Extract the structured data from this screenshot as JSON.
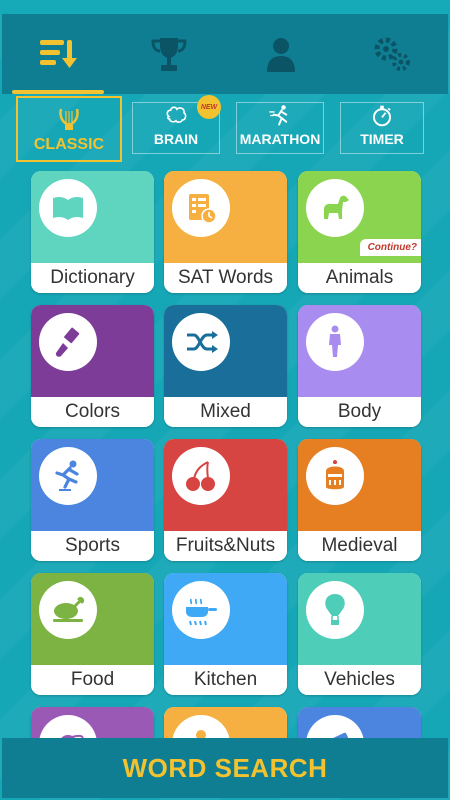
{
  "top_nav": {
    "items": [
      {
        "name": "list-sort-icon",
        "active": true
      },
      {
        "name": "trophy-icon",
        "active": false
      },
      {
        "name": "profile-icon",
        "active": false
      },
      {
        "name": "settings-gears-icon",
        "active": false
      }
    ],
    "accent": "#f2c230"
  },
  "modes": [
    {
      "label": "CLASSIC",
      "icon": "lyre-icon",
      "active": true
    },
    {
      "label": "BRAIN",
      "icon": "brain-icon",
      "badge": "NEW"
    },
    {
      "label": "MARATHON",
      "icon": "runner-icon"
    },
    {
      "label": "TIMER",
      "icon": "stopwatch-icon"
    }
  ],
  "categories": [
    {
      "label": "Dictionary",
      "color": "#5fd4bf",
      "icon": "book-icon"
    },
    {
      "label": "SAT Words",
      "color": "#f5b041",
      "icon": "worksheet-icon"
    },
    {
      "label": "Animals",
      "color": "#8bd450",
      "icon": "dog-icon",
      "note": "Continue?"
    },
    {
      "label": "Colors",
      "color": "#7d3c98",
      "icon": "paintbrush-icon"
    },
    {
      "label": "Mixed",
      "color": "#1a6f9a",
      "icon": "shuffle-icon"
    },
    {
      "label": "Body",
      "color": "#a98cf0",
      "icon": "human-body-icon"
    },
    {
      "label": "Sports",
      "color": "#4b85e0",
      "icon": "skater-icon"
    },
    {
      "label": "Fruits&Nuts",
      "color": "#d64541",
      "icon": "cherries-icon"
    },
    {
      "label": "Medieval",
      "color": "#e67e22",
      "icon": "knight-helmet-icon"
    },
    {
      "label": "Food",
      "color": "#7cb342",
      "icon": "roast-chicken-icon"
    },
    {
      "label": "Kitchen",
      "color": "#3fa9f5",
      "icon": "frying-pan-icon"
    },
    {
      "label": "Vehicles",
      "color": "#4ecdb8",
      "icon": "hot-air-balloon-icon"
    },
    {
      "label": "",
      "color": "#9b59b6",
      "icon": "planet-icon"
    },
    {
      "label": "",
      "color": "#f5b041",
      "icon": "pin-icon"
    },
    {
      "label": "",
      "color": "#4b85e0",
      "icon": "telescope-icon"
    }
  ],
  "footer": {
    "title": "WORD SEARCH"
  }
}
